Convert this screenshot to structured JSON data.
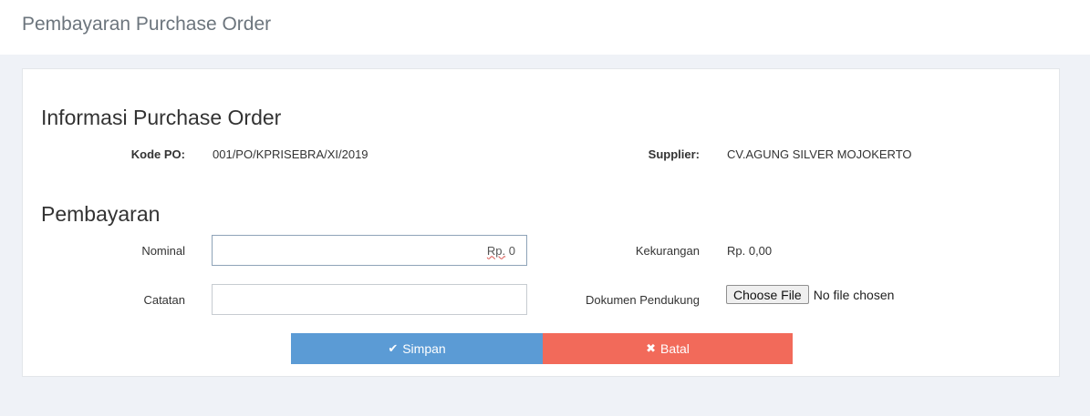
{
  "header": {
    "title": "Pembayaran Purchase Order"
  },
  "info_section": {
    "title": "Informasi Purchase Order",
    "kode_po_label": "Kode PO:",
    "kode_po_value": "001/PO/KPRISEBRA/XI/2019",
    "supplier_label": "Supplier:",
    "supplier_value": "CV.AGUNG SILVER MOJOKERTO"
  },
  "payment_section": {
    "title": "Pembayaran",
    "nominal_label": "Nominal",
    "nominal_prefix": "Rp.",
    "nominal_value": "0",
    "kekurangan_label": "Kekurangan",
    "kekurangan_value": "Rp. 0,00",
    "catatan_label": "Catatan",
    "catatan_value": "",
    "dokumen_label": "Dokumen Pendukung",
    "file_button_label": "Choose File",
    "file_status": "No file chosen"
  },
  "actions": {
    "save_label": "Simpan",
    "save_icon": "check-icon",
    "cancel_label": "Batal",
    "cancel_icon": "times-icon"
  },
  "colors": {
    "save": "#5b9bd5",
    "cancel": "#f26a5a",
    "background": "#eff2f7"
  }
}
